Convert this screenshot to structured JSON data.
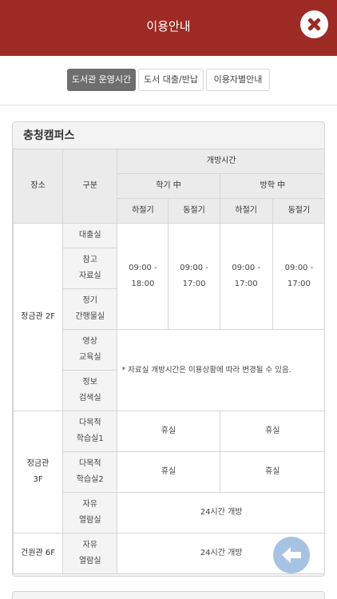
{
  "header": {
    "title": "이용안내"
  },
  "tabs": [
    {
      "label": "도서관 운영시간",
      "active": true
    },
    {
      "label": "도서 대출/반납",
      "active": false
    },
    {
      "label": "이용자별안내",
      "active": false
    }
  ],
  "campus": {
    "name": "충청캠퍼스",
    "columns": {
      "place": "장소",
      "division": "구분",
      "hours": "개방시간",
      "semester": "학기 中",
      "vacation": "방학 中",
      "summer": "하절기",
      "winter": "동절기"
    },
    "rows": {
      "jeonggeum2f": {
        "place": "정금관 2F",
        "loan": "대출실",
        "reference": "참고\n자료실",
        "periodical": "정기\n간행물실",
        "video": "영상\n교육실",
        "info": "정보\n검색실",
        "times": [
          "09:00 -\n18:00",
          "09:00 -\n17:00",
          "09:00 -\n17:00",
          "09:00 -\n17:00"
        ],
        "note": "* 자료실 개방시간은 이용상황에 따라 변경될 수 있음."
      },
      "jeonggeum3f": {
        "place": "정금관\n3F",
        "room1": "다목적\n학습실1",
        "room2": "다목적\n학습실2",
        "free": "자유\n열람실",
        "closed": "휴실",
        "open24": "24시간 개방"
      },
      "geonwon6f": {
        "place": "건원관 6F",
        "free": "자유\n열람실",
        "open24": "24시간 개방"
      }
    }
  },
  "colors": {
    "header": "#9e2a24",
    "back_button": "#9dbde0"
  },
  "icons": {
    "close": "close-icon",
    "back": "arrow-left-icon"
  }
}
